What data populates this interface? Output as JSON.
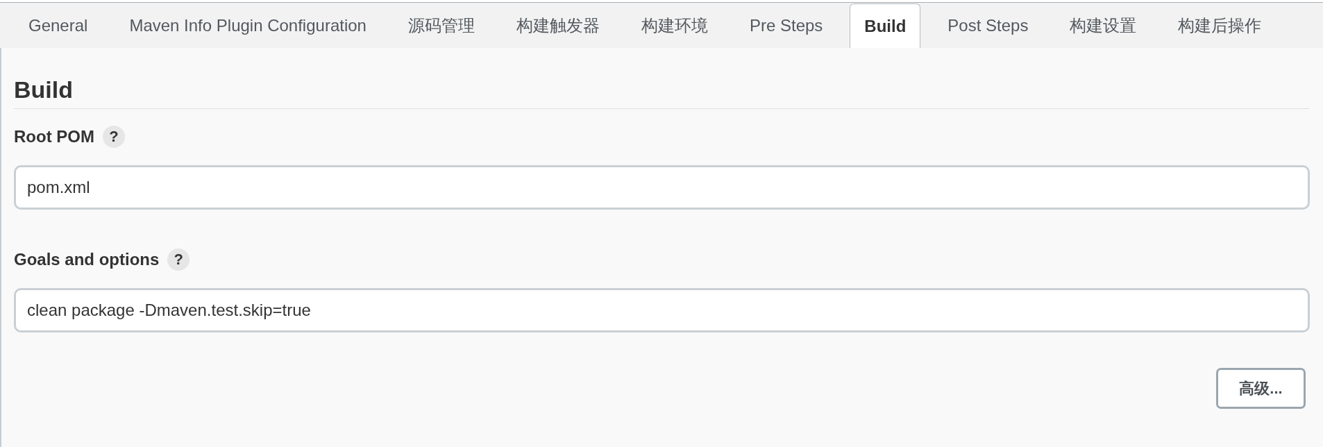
{
  "tabs": [
    {
      "label": "General",
      "selected": false
    },
    {
      "label": "Maven Info Plugin Configuration",
      "selected": false
    },
    {
      "label": "源码管理",
      "selected": false
    },
    {
      "label": "构建触发器",
      "selected": false
    },
    {
      "label": "构建环境",
      "selected": false
    },
    {
      "label": "Pre Steps",
      "selected": false
    },
    {
      "label": "Build",
      "selected": true
    },
    {
      "label": "Post Steps",
      "selected": false
    },
    {
      "label": "构建设置",
      "selected": false
    },
    {
      "label": "构建后操作",
      "selected": false
    }
  ],
  "section": {
    "title": "Build"
  },
  "fields": [
    {
      "label": "Root POM",
      "help": "?",
      "value": "pom.xml"
    },
    {
      "label": "Goals and options",
      "help": "?",
      "value": "clean package -Dmaven.test.skip=true"
    }
  ],
  "buttons": [
    {
      "label": "高级..."
    }
  ]
}
